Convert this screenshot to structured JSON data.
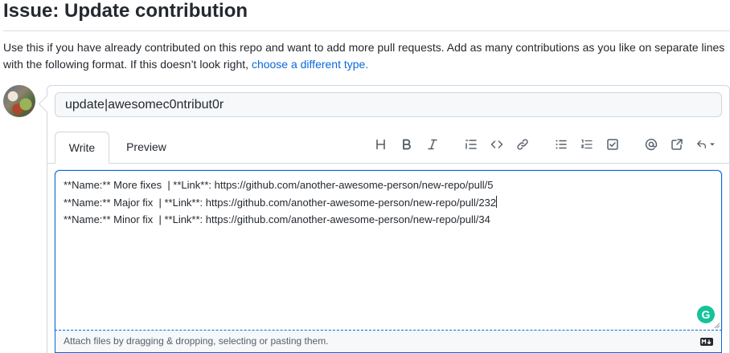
{
  "page": {
    "title": "Issue: Update contribution",
    "intro_text": "Use this if you have already contributed on this repo and want to add more pull requests. Add as many contributions as you like on separate lines with the following format. If this doesn’t look right, ",
    "intro_link": "choose a different type."
  },
  "form": {
    "title_value": "update|awesomec0ntribut0r",
    "tabs": {
      "write": "Write",
      "preview": "Preview"
    },
    "toolbar_icons": [
      "heading-icon",
      "bold-icon",
      "italic-icon",
      "quote-icon",
      "code-icon",
      "link-icon",
      "bulleted-list-icon",
      "numbered-list-icon",
      "task-list-icon",
      "mention-icon",
      "reference-icon",
      "saved-replies-icon"
    ],
    "body_lines": [
      "**Name:** More fixes  | **Link**: https://github.com/another-awesome-person/new-repo/pull/5",
      "**Name:** Major fix  | **Link**: https://github.com/another-awesome-person/new-repo/pull/232",
      "**Name:** Minor fix  | **Link**: https://github.com/another-awesome-person/new-repo/pull/34"
    ],
    "grammarly_label": "G",
    "attach_text": "Attach files by dragging & dropping, selecting or pasting them."
  },
  "colors": {
    "accent": "#0969da",
    "border": "#d0d7de",
    "grammarly": "#15c39a"
  }
}
